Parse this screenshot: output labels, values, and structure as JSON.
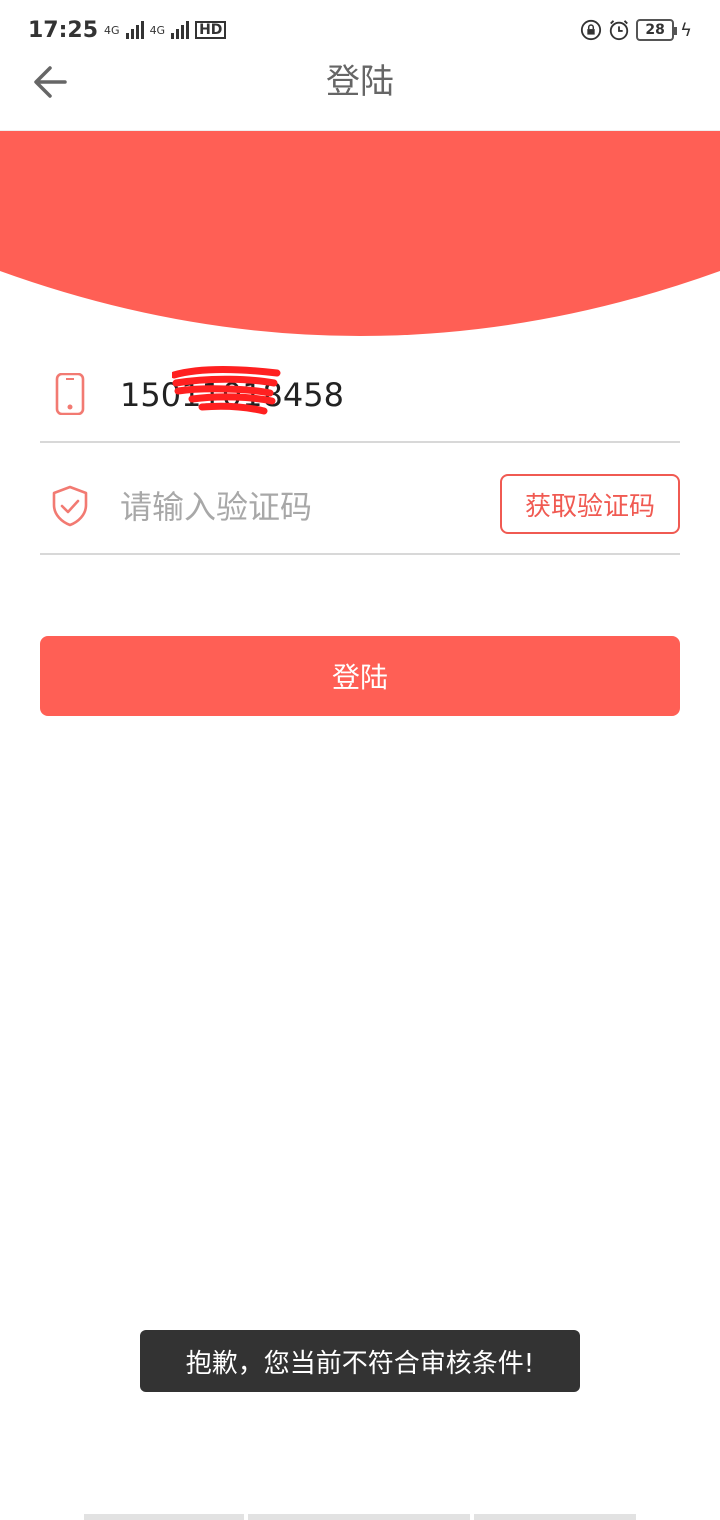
{
  "status_bar": {
    "time": "17:25",
    "sim1_label": "4G",
    "sim2_label": "4G",
    "hd_label": "HD",
    "battery_level": "28"
  },
  "header": {
    "title": "登陆"
  },
  "form": {
    "phone_value": "15011018458",
    "code_placeholder": "请输入验证码",
    "get_code_label": "获取验证码"
  },
  "login_button_label": "登陆",
  "toast_message": "抱歉，您当前不符合审核条件!",
  "colors": {
    "brand_red": "#ff5f55",
    "accent_red": "#f05a52",
    "toast_bg": "#333333"
  },
  "icons": {
    "back": "arrow-left-icon",
    "phone": "phone-icon",
    "code": "shield-check-icon",
    "alarm": "alarm-icon",
    "lock": "rotation-lock-icon"
  }
}
